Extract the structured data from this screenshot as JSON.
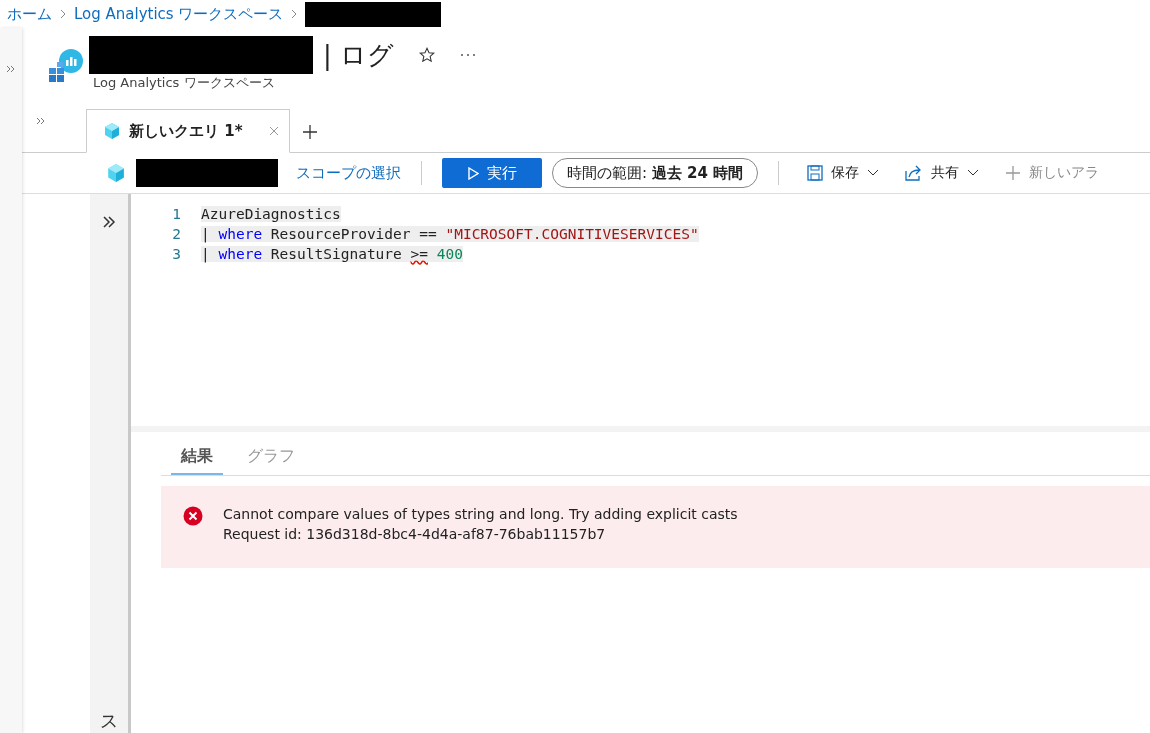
{
  "breadcrumb": [
    "ホーム",
    "Log Analytics ワークスペース"
  ],
  "header": {
    "title": "| ログ",
    "subtitle": "Log Analytics ワークスペース"
  },
  "query_tabs": [
    {
      "label": "新しいクエリ 1*",
      "selected": true
    }
  ],
  "toolbar": {
    "scope_link": "スコープの選択",
    "run_button": "実行",
    "time_range_label": "時間の範囲:",
    "time_range_value": "過去 24 時間",
    "save": "保存",
    "share": "共有",
    "new_alert": "新しいアラ"
  },
  "editor": {
    "lines": [
      {
        "number": "1",
        "tokens": [
          {
            "kind": "plain",
            "text": "AzureDiagnostics"
          }
        ]
      },
      {
        "number": "2",
        "tokens": [
          {
            "kind": "plain",
            "text": "| "
          },
          {
            "kind": "keyword",
            "text": "where"
          },
          {
            "kind": "plain",
            "text": " ResourceProvider == "
          },
          {
            "kind": "string",
            "text": "\"MICROSOFT.COGNITIVESERVICES\""
          }
        ]
      },
      {
        "number": "3",
        "tokens": [
          {
            "kind": "plain",
            "text": "| "
          },
          {
            "kind": "keyword",
            "text": "where"
          },
          {
            "kind": "plain",
            "text": " ResultSignature "
          },
          {
            "kind": "error",
            "text": ">="
          },
          {
            "kind": "number",
            "text": " 400"
          }
        ]
      }
    ]
  },
  "side_panel_label": "ス",
  "result_tabs": [
    {
      "label": "結果",
      "selected": true
    },
    {
      "label": "グラフ",
      "selected": false
    }
  ],
  "error": {
    "message": "Cannot compare values of types string and long. Try adding explicit casts",
    "request_id": "Request id: 136d318d-8bc4-4d4a-af87-76bab11157b7"
  }
}
